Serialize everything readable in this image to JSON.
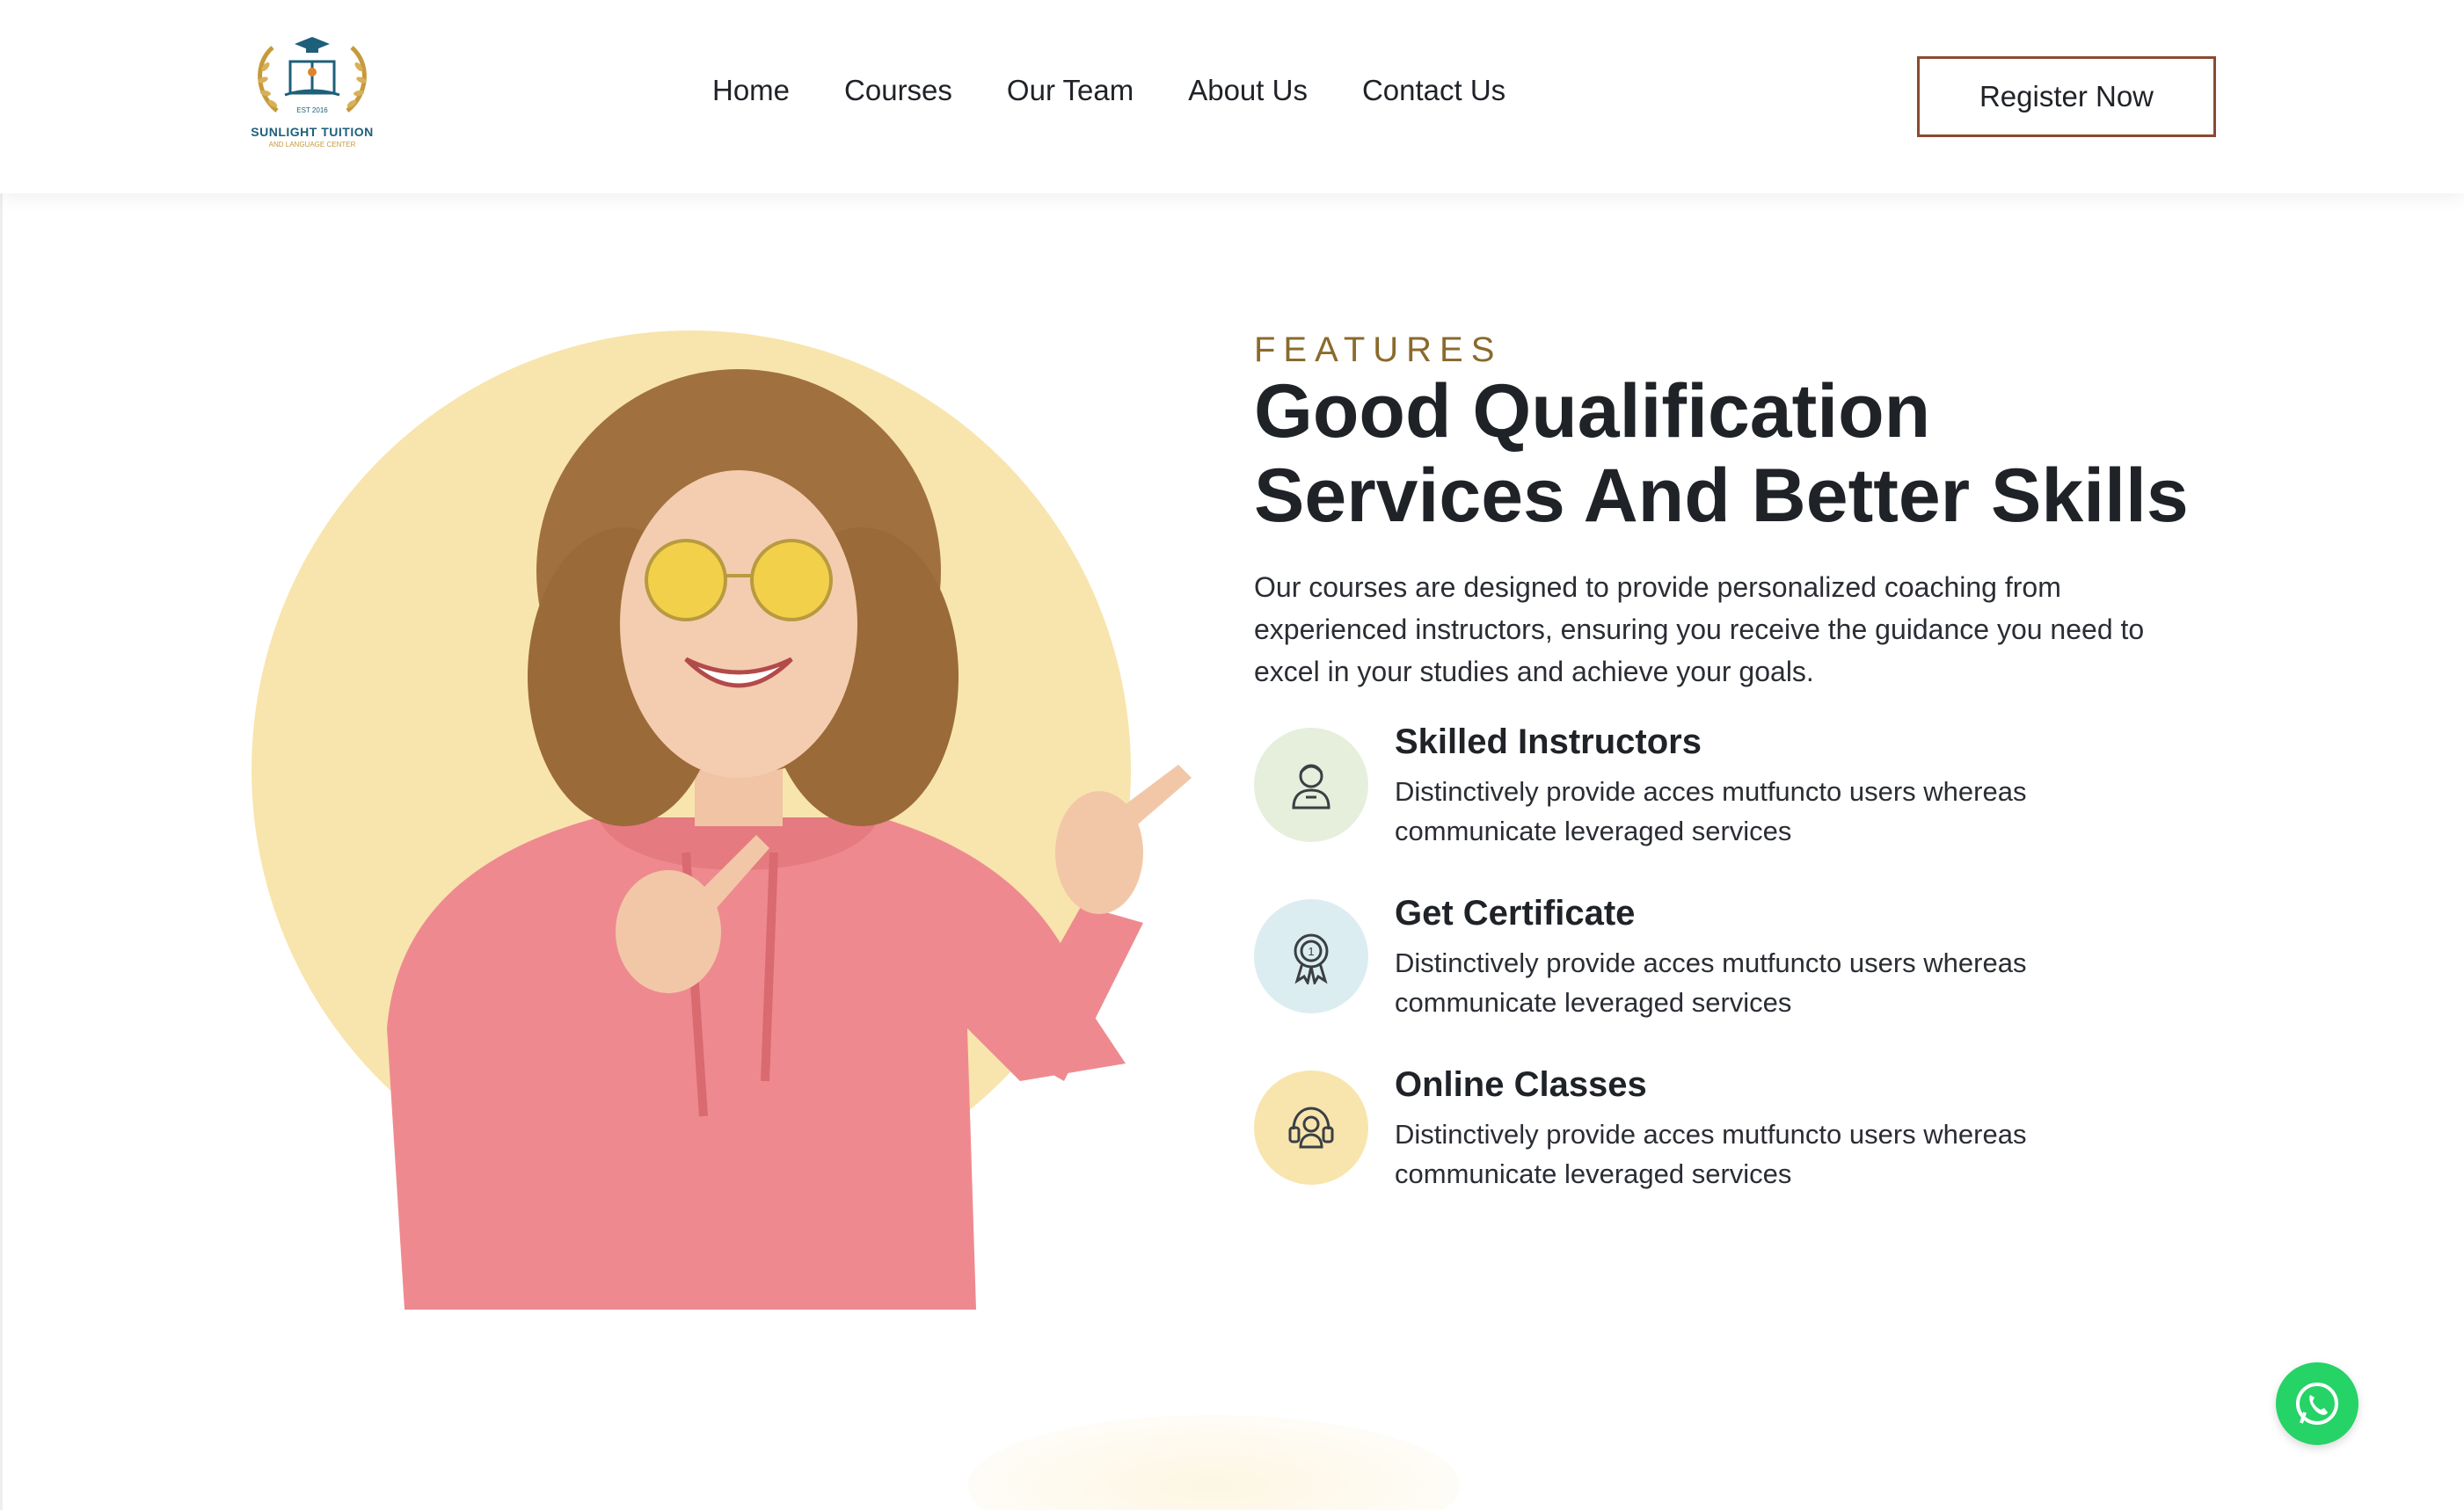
{
  "brand": {
    "name": "SUNLIGHT TUITION",
    "sub": "AND LANGUAGE CENTER",
    "est": "EST 2016",
    "colors": {
      "accent": "#8a4a30",
      "gold": "#8a6a2c",
      "navy": "#1e5f7a"
    }
  },
  "nav": {
    "items": [
      {
        "label": "Home"
      },
      {
        "label": "Courses"
      },
      {
        "label": "Our Team"
      },
      {
        "label": "About Us"
      },
      {
        "label": "Contact Us"
      }
    ],
    "cta": "Register Now"
  },
  "hero": {
    "eyebrow": "FEATURES",
    "title_line1": "Good Qualification",
    "title_line2": "Services And Better Skills",
    "description": "Our courses are designed to provide personalized coaching from experienced instructors, ensuring you receive the guidance you need to excel in your studies and achieve your goals.",
    "circle_color": "#f8e5ad"
  },
  "features": [
    {
      "title": "Skilled Instructors",
      "text": "Distinctively provide acces mutfuncto users whereas communicate leveraged services",
      "icon": "instructor-icon",
      "bg": "#e6efdc"
    },
    {
      "title": "Get Certificate",
      "text": "Distinctively provide acces mutfuncto users whereas communicate leveraged services",
      "icon": "certificate-icon",
      "bg": "#dcedf1"
    },
    {
      "title": "Online Classes",
      "text": "Distinctively provide acces mutfuncto users whereas communicate leveraged services",
      "icon": "headset-icon",
      "bg": "#f8e5ad"
    }
  ],
  "whatsapp": {
    "icon": "whatsapp-icon",
    "color": "#25d366"
  }
}
